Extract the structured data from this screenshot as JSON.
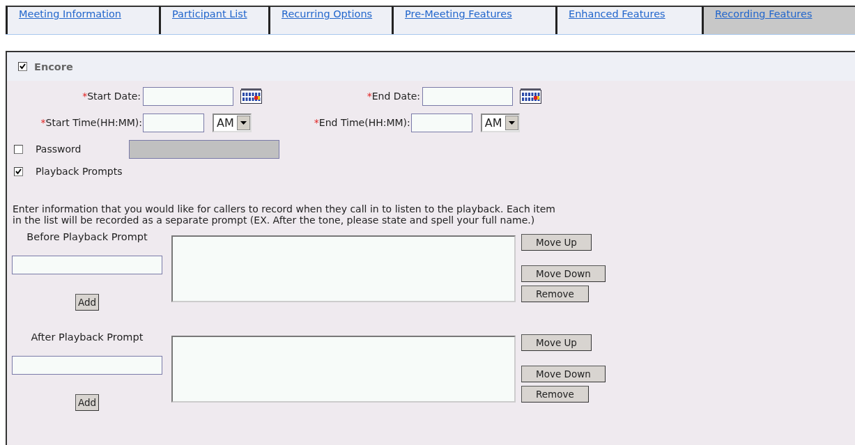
{
  "tabs": [
    {
      "label": "Meeting Information",
      "selected": false
    },
    {
      "label": "Participant List",
      "selected": false
    },
    {
      "label": "Recurring Options",
      "selected": false
    },
    {
      "label": "Pre-Meeting Features",
      "selected": false
    },
    {
      "label": "Enhanced Features",
      "selected": false
    },
    {
      "label": "Recording Features",
      "selected": true
    }
  ],
  "encore": {
    "label": "Encore",
    "checked": true
  },
  "date_fields": [
    {
      "marker": "*",
      "label": "Start Date:"
    },
    {
      "marker": "*",
      "label": "End Date:"
    }
  ],
  "time_fields": [
    {
      "marker": "*",
      "label": "Start Time(HH:MM):",
      "period": "AM"
    },
    {
      "marker": "*",
      "label": "End Time(HH:MM):",
      "period": "AM"
    }
  ],
  "password": {
    "label": "Password",
    "checked": false,
    "disabled": true
  },
  "playback_prompts": {
    "label": "Playback Prompts",
    "checked": true
  },
  "instructions": "Enter information that you would like for callers to record when they call in to listen to the playback. Each item in the list will be recorded as a separate prompt (EX. After the tone, please state and spell your full name.)",
  "prompt_lists": [
    {
      "label": "Before Playback Prompt",
      "add_button": "Add",
      "buttons": [
        "Move Up",
        "Move Down",
        "Remove"
      ]
    },
    {
      "label": "After Playback Prompt",
      "add_button": "Add",
      "buttons": [
        "Move Up",
        "Move Down",
        "Remove"
      ]
    }
  ]
}
